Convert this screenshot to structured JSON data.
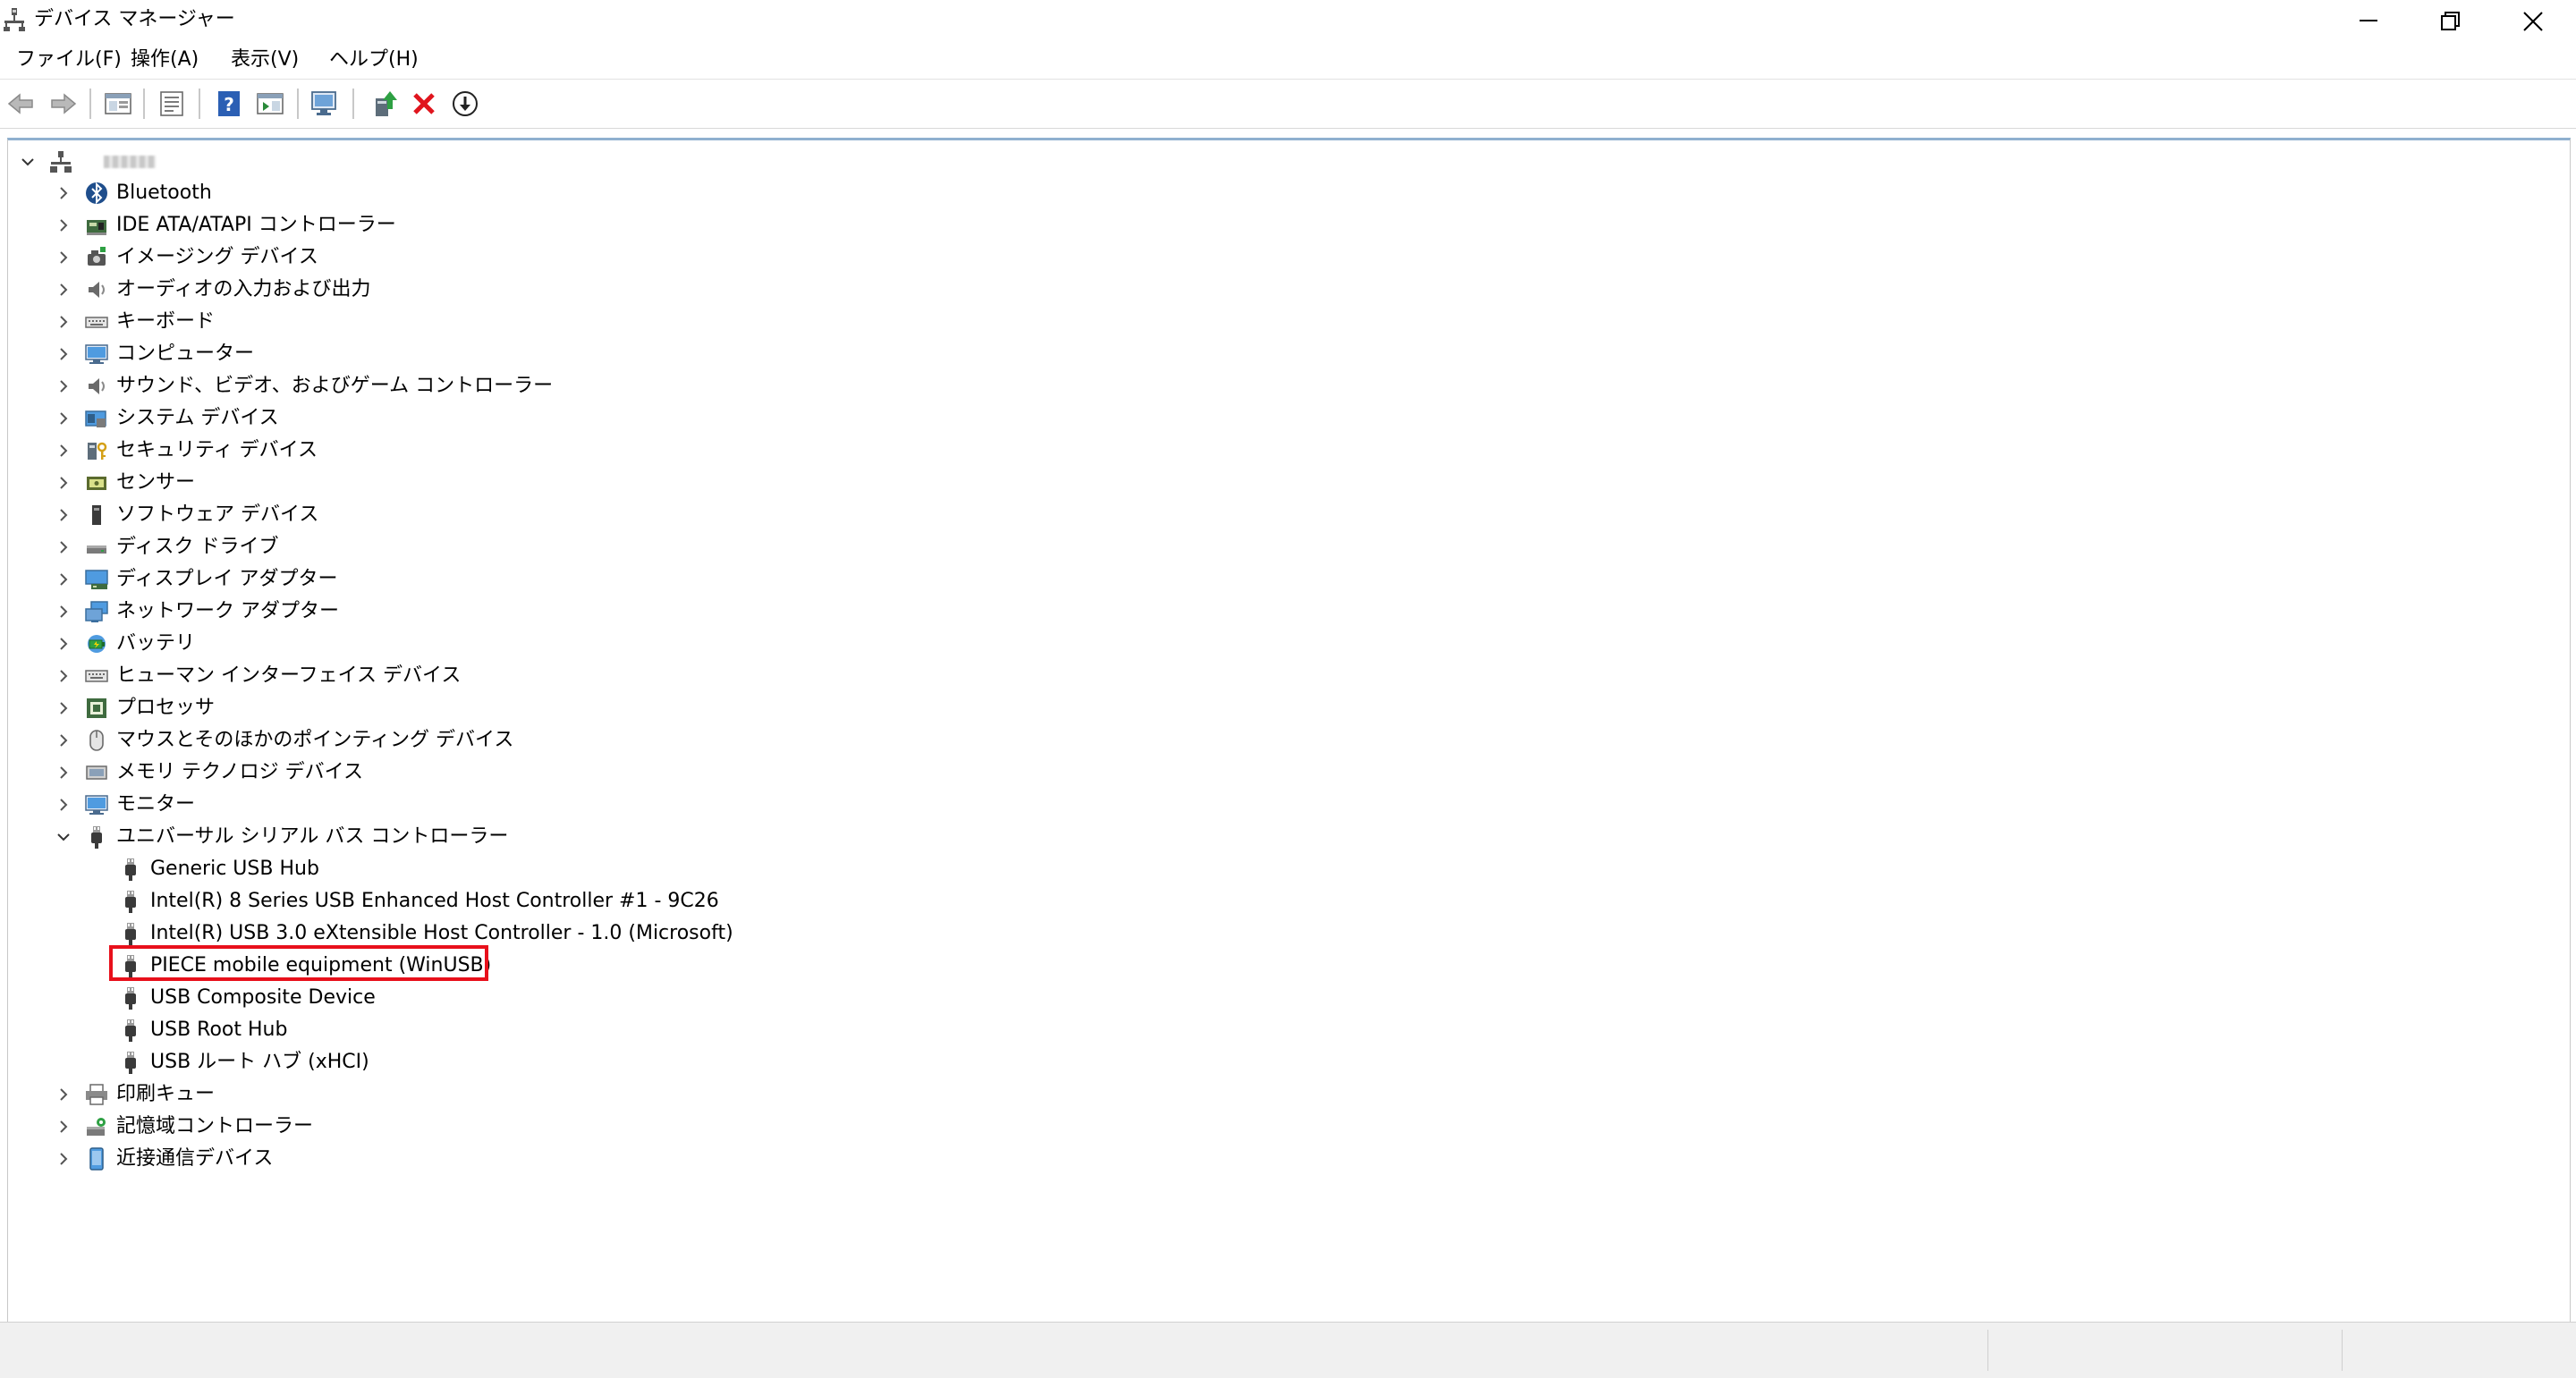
{
  "window": {
    "title": "デバイス マネージャー",
    "controls": [
      "minimize",
      "restore",
      "close"
    ]
  },
  "menu": [
    {
      "label": "ファイル(F)"
    },
    {
      "label": "操作(A)"
    },
    {
      "label": "表示(V)"
    },
    {
      "label": "ヘルプ(H)"
    }
  ],
  "toolbar": {
    "buttons": [
      "back-arrow-icon",
      "forward-arrow-icon",
      "console-tree-icon",
      "properties-icon",
      "help-icon",
      "action-pane-icon",
      "scan-hardware-icon",
      "update-driver-icon",
      "uninstall-device-icon",
      "enable-device-icon"
    ]
  },
  "tree": {
    "root": {
      "label": "",
      "expanded": true,
      "icon": "computer-root-icon"
    },
    "categories": [
      {
        "label": "Bluetooth",
        "icon": "bluetooth-icon"
      },
      {
        "label": "IDE ATA/ATAPI コントローラー",
        "icon": "ide-controller-icon"
      },
      {
        "label": "イメージング デバイス",
        "icon": "imaging-device-icon"
      },
      {
        "label": "オーディオの入力および出力",
        "icon": "audio-icon"
      },
      {
        "label": "キーボード",
        "icon": "keyboard-icon"
      },
      {
        "label": "コンピューター",
        "icon": "computer-icon"
      },
      {
        "label": "サウンド、ビデオ、およびゲーム コントローラー",
        "icon": "speaker-icon"
      },
      {
        "label": "システム デバイス",
        "icon": "system-device-icon"
      },
      {
        "label": "セキュリティ デバイス",
        "icon": "security-key-icon"
      },
      {
        "label": "センサー",
        "icon": "sensor-icon"
      },
      {
        "label": "ソフトウェア デバイス",
        "icon": "software-device-icon"
      },
      {
        "label": "ディスク ドライブ",
        "icon": "disk-drive-icon"
      },
      {
        "label": "ディスプレイ アダプター",
        "icon": "display-adapter-icon"
      },
      {
        "label": "ネットワーク アダプター",
        "icon": "network-adapter-icon"
      },
      {
        "label": "バッテリ",
        "icon": "battery-icon"
      },
      {
        "label": "ヒューマン インターフェイス デバイス",
        "icon": "hid-icon"
      },
      {
        "label": "プロセッサ",
        "icon": "processor-icon"
      },
      {
        "label": "マウスとそのほかのポインティング デバイス",
        "icon": "mouse-icon"
      },
      {
        "label": "メモリ テクノロジ デバイス",
        "icon": "memory-icon"
      },
      {
        "label": "モニター",
        "icon": "monitor-icon"
      },
      {
        "label": "ユニバーサル シリアル バス コントローラー",
        "icon": "usb-icon",
        "expanded": true,
        "children": [
          {
            "label": "Generic USB Hub"
          },
          {
            "label": "Intel(R) 8 Series USB Enhanced Host Controller #1 - 9C26"
          },
          {
            "label": "Intel(R) USB 3.0 eXtensible Host Controller - 1.0 (Microsoft)"
          },
          {
            "label": "PIECE mobile equipment (WinUSB)",
            "highlighted": true
          },
          {
            "label": "USB Composite Device"
          },
          {
            "label": "USB Root Hub"
          },
          {
            "label": "USB ルート ハブ (xHCI)"
          }
        ]
      },
      {
        "label": "印刷キュー",
        "icon": "print-queue-icon"
      },
      {
        "label": "記憶域コントローラー",
        "icon": "storage-controller-icon"
      },
      {
        "label": "近接通信デバイス",
        "icon": "proximity-device-icon"
      }
    ]
  },
  "colors": {
    "highlight_border": "#e8101b",
    "tree_top_border": "#8fb0cf",
    "status_bar": "#f0f0f0"
  }
}
